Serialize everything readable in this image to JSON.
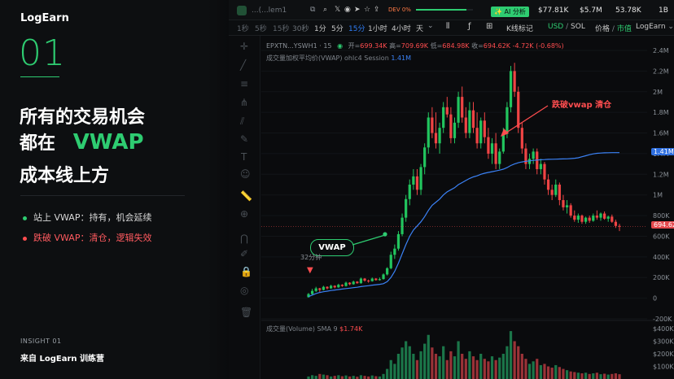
{
  "intro": {
    "logo": "LogEarn",
    "number": "01",
    "headline_line1": "所有的交易机会",
    "headline_line2_prefix": "都在",
    "headline_line2_highlight": "VWAP",
    "headline_line3": "成本线上方",
    "bullet_1": "站上 VWAP：持有，机会延续",
    "bullet_2": "跌破 VWAP：清仓，逻辑失效",
    "insight": "INSIGHT 01",
    "source": "来自 LogEarn 训练营",
    "colors": {
      "accent": "#2ecc71",
      "danger": "#ff4d4f"
    }
  },
  "toolbar": {
    "token_label": "...(...lem1",
    "dev_badge": "DEV 0%",
    "ai_button": "✨ AI 分析",
    "stats": [
      "$77.81K",
      "$5.7M",
      "53.78K",
      "1B"
    ]
  },
  "timeframes": [
    "1秒",
    "5秒",
    "15秒",
    "30秒",
    "1分",
    "5分",
    "15分",
    "1小时",
    "4小时",
    "天"
  ],
  "active_timeframe": "15分",
  "chart_toolbar": {
    "kline_label": "K线标记",
    "currency_usd": "USD",
    "currency_sep": "/",
    "currency_sol": "SOL",
    "price_label": "价格",
    "price_sep": "/",
    "mcap_label": "市值",
    "brand": "LogEarn"
  },
  "legend": {
    "symbol": "EPXTN...YSWH1 · 15",
    "open_label": "开=",
    "open": "699.34K",
    "high_label": "高=",
    "high": "709.69K",
    "low_label": "低=",
    "low": "684.98K",
    "close_label": "收=",
    "close": "694.62K",
    "change": "-4.72K (-0.68%)",
    "vwap_line": "成交量加权平均价(VWAP) ohlc4 Session",
    "vwap_value": "1.41M",
    "volume_line": "成交量(Volume) SMA 9",
    "volume_value": "$1.74K"
  },
  "annotations": {
    "vwap_tag": "VWAP",
    "breakdown": "跌破vwap 清仓",
    "time_marker": "32分钟"
  },
  "axis": {
    "price_ticks": [
      "2.4M",
      "2.2M",
      "2M",
      "1.8M",
      "1.6M",
      "1.4M",
      "1.2M",
      "1M",
      "800K",
      "600K",
      "400K",
      "200K",
      "0",
      "-200K"
    ],
    "vwap_label": "1.41M",
    "last_label": "694.62",
    "volume_ticks": [
      "$400K",
      "$300K",
      "$200K",
      "$100K"
    ]
  },
  "chart_data": {
    "type": "candlestick",
    "ylim": [
      -200000,
      2400000
    ],
    "candles": [
      [
        10000,
        50000,
        5000,
        40000
      ],
      [
        40000,
        90000,
        30000,
        70000
      ],
      [
        70000,
        110000,
        60000,
        95000
      ],
      [
        95000,
        100000,
        60000,
        80000
      ],
      [
        80000,
        120000,
        75000,
        110000
      ],
      [
        110000,
        115000,
        85000,
        95000
      ],
      [
        95000,
        130000,
        90000,
        120000
      ],
      [
        120000,
        125000,
        95000,
        105000
      ],
      [
        105000,
        140000,
        100000,
        130000
      ],
      [
        130000,
        135000,
        110000,
        118000
      ],
      [
        118000,
        160000,
        112000,
        150000
      ],
      [
        150000,
        155000,
        125000,
        135000
      ],
      [
        135000,
        170000,
        130000,
        160000
      ],
      [
        160000,
        165000,
        140000,
        145000
      ],
      [
        145000,
        200000,
        140000,
        190000
      ],
      [
        190000,
        195000,
        160000,
        170000
      ],
      [
        170000,
        180000,
        150000,
        165000
      ],
      [
        165000,
        200000,
        160000,
        190000
      ],
      [
        190000,
        195000,
        170000,
        175000
      ],
      [
        175000,
        200000,
        170000,
        185000
      ],
      [
        185000,
        240000,
        180000,
        230000
      ],
      [
        230000,
        300000,
        220000,
        290000
      ],
      [
        290000,
        450000,
        280000,
        420000
      ],
      [
        420000,
        520000,
        380000,
        480000
      ],
      [
        480000,
        650000,
        460000,
        620000
      ],
      [
        620000,
        820000,
        600000,
        780000
      ],
      [
        780000,
        1000000,
        740000,
        960000
      ],
      [
        960000,
        1150000,
        900000,
        1100000
      ],
      [
        1100000,
        1250000,
        1050000,
        1180000
      ],
      [
        1180000,
        1250000,
        1000000,
        1050000
      ],
      [
        1050000,
        1300000,
        1000000,
        1270000
      ],
      [
        1270000,
        1500000,
        1200000,
        1460000
      ],
      [
        1460000,
        1800000,
        1400000,
        1750000
      ],
      [
        1750000,
        1850000,
        1550000,
        1600000
      ],
      [
        1600000,
        1800000,
        1450000,
        1500000
      ],
      [
        1500000,
        1700000,
        1400000,
        1650000
      ],
      [
        1650000,
        1900000,
        1600000,
        1850000
      ],
      [
        1850000,
        1950000,
        1750000,
        1780000
      ],
      [
        1780000,
        1850000,
        1500000,
        1550000
      ],
      [
        1550000,
        1750000,
        1500000,
        1700000
      ],
      [
        1700000,
        2000000,
        1650000,
        1950000
      ],
      [
        1950000,
        2050000,
        1700000,
        1750000
      ],
      [
        1750000,
        1850000,
        1550000,
        1600000
      ],
      [
        1600000,
        1900000,
        1550000,
        1820000
      ],
      [
        1820000,
        1900000,
        1600000,
        1650000
      ],
      [
        1650000,
        1800000,
        1450000,
        1500000
      ],
      [
        1500000,
        1750000,
        1450000,
        1720000
      ],
      [
        1720000,
        1800000,
        1500000,
        1560000
      ],
      [
        1560000,
        1650000,
        1350000,
        1400000
      ],
      [
        1400000,
        1550000,
        1300000,
        1500000
      ],
      [
        1500000,
        1600000,
        1250000,
        1300000
      ],
      [
        1300000,
        1450000,
        1250000,
        1420000
      ],
      [
        1420000,
        1650000,
        1400000,
        1600000
      ],
      [
        1600000,
        1900000,
        1550000,
        1850000
      ],
      [
        1850000,
        2250000,
        1800000,
        2200000
      ],
      [
        2200000,
        2280000,
        1950000,
        2000000
      ],
      [
        2000000,
        2050000,
        1600000,
        1650000
      ],
      [
        1650000,
        1700000,
        1400000,
        1450000
      ],
      [
        1450000,
        1500000,
        1250000,
        1300000
      ],
      [
        1300000,
        1400000,
        1250000,
        1350000
      ],
      [
        1350000,
        1450000,
        1300000,
        1420000
      ],
      [
        1420000,
        1450000,
        1200000,
        1250000
      ],
      [
        1250000,
        1350000,
        1200000,
        1300000
      ],
      [
        1300000,
        1320000,
        1100000,
        1150000
      ],
      [
        1150000,
        1200000,
        1000000,
        1050000
      ],
      [
        1050000,
        1100000,
        950000,
        1000000
      ],
      [
        1000000,
        1150000,
        980000,
        1100000
      ],
      [
        1100000,
        1120000,
        900000,
        950000
      ],
      [
        950000,
        1000000,
        850000,
        880000
      ],
      [
        880000,
        950000,
        820000,
        900000
      ],
      [
        900000,
        920000,
        780000,
        800000
      ],
      [
        800000,
        850000,
        740000,
        760000
      ],
      [
        760000,
        820000,
        730000,
        800000
      ],
      [
        800000,
        810000,
        720000,
        740000
      ],
      [
        740000,
        790000,
        720000,
        780000
      ],
      [
        780000,
        800000,
        730000,
        750000
      ],
      [
        750000,
        820000,
        740000,
        800000
      ],
      [
        800000,
        850000,
        760000,
        780000
      ],
      [
        780000,
        830000,
        750000,
        820000
      ],
      [
        820000,
        840000,
        760000,
        770000
      ],
      [
        770000,
        800000,
        740000,
        790000
      ],
      [
        790000,
        810000,
        730000,
        740000
      ],
      [
        740000,
        760000,
        680000,
        700000
      ],
      [
        700000,
        720000,
        650000,
        694620
      ]
    ],
    "vwap_series": [
      15000,
      30000,
      45000,
      55000,
      62000,
      68000,
      74000,
      79000,
      84000,
      88000,
      93000,
      97000,
      102000,
      106000,
      112000,
      117000,
      121000,
      126000,
      130000,
      134000,
      140000,
      160000,
      200000,
      260000,
      340000,
      430000,
      520000,
      600000,
      660000,
      700000,
      740000,
      790000,
      850000,
      900000,
      930000,
      960000,
      1000000,
      1030000,
      1050000,
      1070000,
      1100000,
      1120000,
      1140000,
      1160000,
      1175000,
      1185000,
      1200000,
      1210000,
      1218000,
      1225000,
      1232000,
      1240000,
      1250000,
      1265000,
      1285000,
      1300000,
      1312000,
      1320000,
      1326000,
      1330000,
      1335000,
      1338000,
      1341000,
      1343000,
      1345000,
      1346000,
      1347000,
      1348000,
      1349000,
      1350000,
      1352000,
      1355000,
      1360000,
      1370000,
      1380000,
      1390000,
      1398000,
      1403000,
      1406000,
      1408000,
      1409000,
      1410000,
      1410000,
      1410000
    ],
    "volume_scale_max": 400000,
    "volumes": [
      20000,
      30000,
      25000,
      40000,
      35000,
      30000,
      20000,
      25000,
      30000,
      22000,
      28000,
      20000,
      25000,
      18000,
      30000,
      25000,
      20000,
      28000,
      22000,
      20000,
      40000,
      80000,
      150000,
      120000,
      200000,
      250000,
      300000,
      260000,
      200000,
      150000,
      220000,
      280000,
      350000,
      250000,
      200000,
      180000,
      260000,
      150000,
      220000,
      180000,
      300000,
      200000,
      160000,
      220000,
      180000,
      150000,
      200000,
      160000,
      140000,
      180000,
      150000,
      170000,
      200000,
      260000,
      380000,
      300000,
      260000,
      200000,
      160000,
      120000,
      140000,
      160000,
      110000,
      120000,
      100000,
      90000,
      110000,
      95000,
      80000,
      70000,
      60000,
      55000,
      50000,
      45000,
      50000,
      40000,
      45000,
      50000,
      38000,
      42000,
      35000,
      40000,
      45000,
      38000
    ]
  }
}
